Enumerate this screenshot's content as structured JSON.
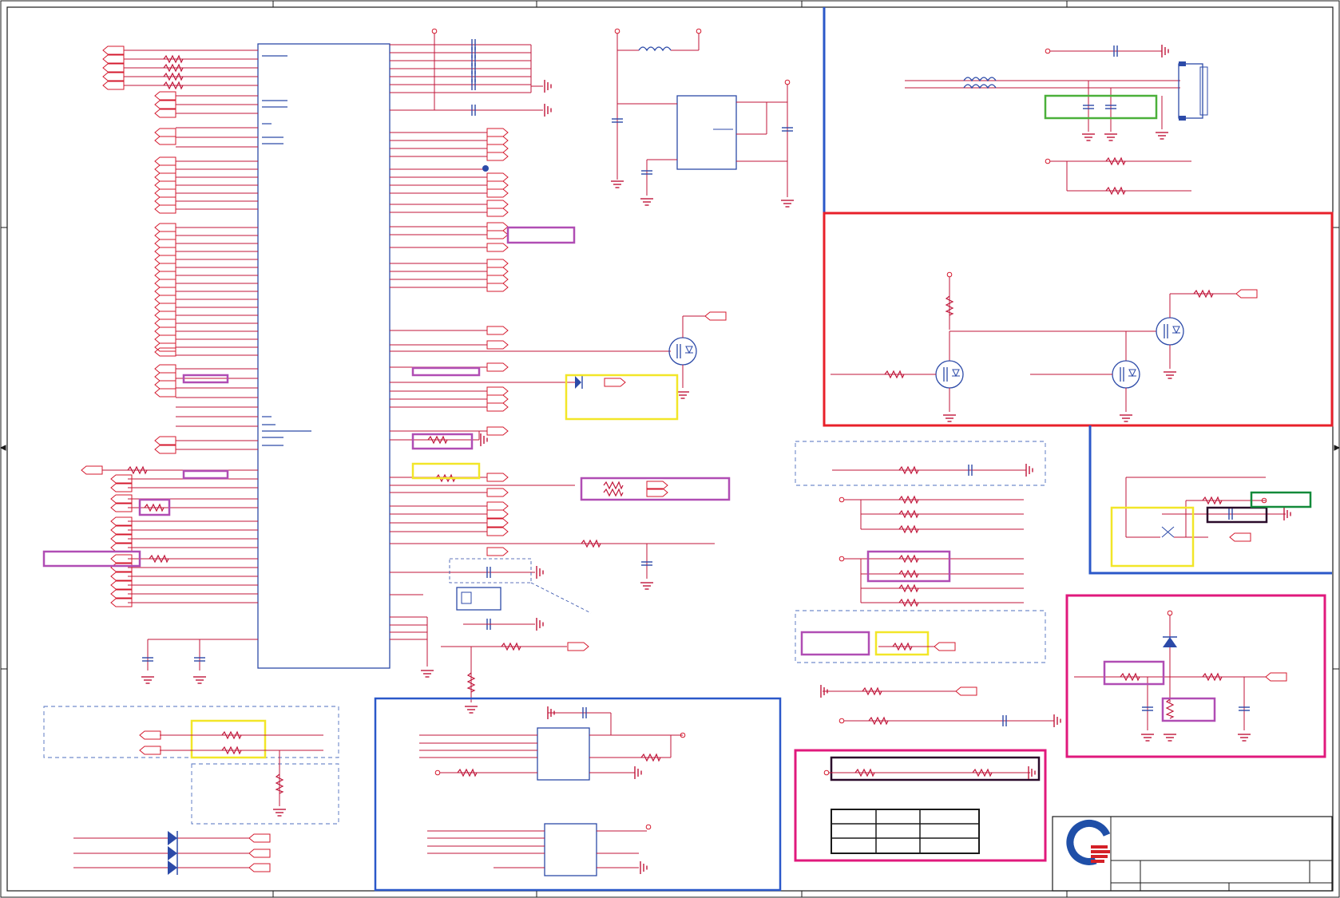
{
  "sheet": {
    "background": "#ffffff",
    "frame_color": "#1a1a1a",
    "wire_color": "#c0163a",
    "net_color": "#d4192e",
    "part_color": "#2c4aa8",
    "text_color": "#2c4aa8"
  },
  "icons": {
    "company_logo": "quanta-logo-icon",
    "ground": "ground-icon",
    "power_pin": "power-pin-icon",
    "net_port": "net-port-icon",
    "resistor": "resistor-icon",
    "capacitor": "capacitor-icon",
    "inductor": "inductor-icon",
    "mosfet": "mosfet-icon",
    "diode": "diode-icon",
    "connector": "connector-icon"
  },
  "highlights": {
    "review_red": "#e8202a",
    "review_blue": "#2b58c9",
    "review_magenta": "#e0197c",
    "review_yellow": "#f2e628",
    "review_green": "#4bb03a",
    "review_violet": "#b04db4",
    "review_dark": "#2a0a2a",
    "review_dkgreen": "#138a3a",
    "dashed_group": "#4f6fbf"
  },
  "logo": {
    "ring_color": "#1f4fa8",
    "stripe_color": "#d42027"
  }
}
